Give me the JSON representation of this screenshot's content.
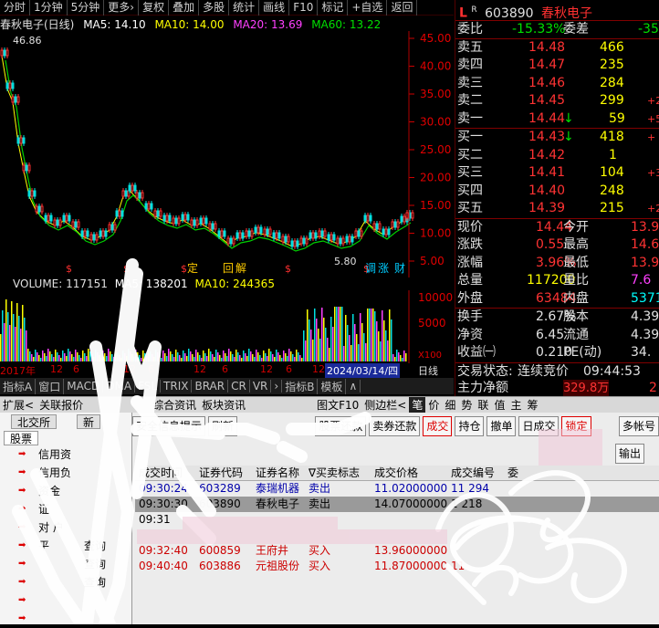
{
  "toolbar": [
    "分时",
    "1分钟",
    "5分钟",
    "更多›",
    "复权",
    "叠加",
    "多股",
    "统计",
    "画线",
    "F10",
    "标记",
    "+自选",
    "返回"
  ],
  "ma_line": {
    "title": "春秋电子(日线)",
    "ma5": "MA5: 14.10",
    "ma10": "MA10: 14.00",
    "ma20": "MA20: 13.69",
    "ma60": "MA60: 13.22"
  },
  "price_marks": {
    "high": "46.86",
    "low": "5.80"
  },
  "price_axis": [
    "45.00",
    "40.00",
    "35.00",
    "30.00",
    "25.00",
    "20.00",
    "15.00",
    "10.00",
    "5.00"
  ],
  "vol_line": {
    "volume": "VOLUME: 117151",
    "ma5": "MA5: 138201",
    "ma10": "MA10: 244365"
  },
  "vol_axis": [
    "10000",
    "5000",
    "X100"
  ],
  "date_axis": [
    "2017年",
    "12",
    "6",
    "12",
    "6",
    "12",
    "6",
    "12",
    "6",
    "12",
    "6",
    "12",
    "6",
    "12"
  ],
  "date_highlight": "2024/03/14/四",
  "date_right": "日线",
  "event_tags": [
    "定",
    "回",
    "解",
    "调",
    "涨",
    "财"
  ],
  "bottom_tabs": [
    "指标A",
    "窗口",
    "MACD",
    "DMA",
    "FSL",
    "TRIX",
    "BRAR",
    "CR",
    "VR",
    "›",
    "指标B",
    "模板",
    "∧"
  ],
  "quote": {
    "marker": "L",
    "sup": "R",
    "code": "603890",
    "name": "春秋电子",
    "weibi_label": "委比",
    "weibi": "-15.33%",
    "weicha_label": "委差",
    "weicha": "-35",
    "sell": [
      {
        "label": "卖五",
        "price": "14.48",
        "vol": "466",
        "chg": ""
      },
      {
        "label": "卖四",
        "price": "14.47",
        "vol": "235",
        "chg": ""
      },
      {
        "label": "卖三",
        "price": "14.46",
        "vol": "284",
        "chg": ""
      },
      {
        "label": "卖二",
        "price": "14.45",
        "vol": "299",
        "chg": "+2"
      },
      {
        "label": "卖一",
        "price": "14.44",
        "vol": "59",
        "chg": "+5",
        "arrow": "↓"
      }
    ],
    "buy": [
      {
        "label": "买一",
        "price": "14.43",
        "vol": "418",
        "chg": "+",
        "arrow": "↓"
      },
      {
        "label": "买二",
        "price": "14.42",
        "vol": "1",
        "chg": ""
      },
      {
        "label": "买三",
        "price": "14.41",
        "vol": "104",
        "chg": "+3"
      },
      {
        "label": "买四",
        "price": "14.40",
        "vol": "248",
        "chg": ""
      },
      {
        "label": "买五",
        "price": "14.39",
        "vol": "215",
        "chg": "+21"
      }
    ],
    "stats": [
      {
        "l1": "现价",
        "v1": "14.44",
        "l2": "今开",
        "v2": "13.9"
      },
      {
        "l1": "涨跌",
        "v1": "0.55",
        "l2": "最高",
        "v2": "14.6"
      },
      {
        "l1": "涨幅",
        "v1": "3.96%",
        "l2": "最低",
        "v2": "13.9"
      },
      {
        "l1": "总量",
        "v1": "117200",
        "l2": "量比",
        "v2": "7.6"
      },
      {
        "l1": "外盘",
        "v1": "63484",
        "l2": "内盘",
        "v2": "5371"
      }
    ],
    "stats2": [
      {
        "l1": "换手",
        "v1": "2.67%",
        "l2": "股本",
        "v2": "4.39亿"
      },
      {
        "l1": "净资",
        "v1": "6.45",
        "l2": "流通",
        "v2": "4.39亿"
      },
      {
        "l1": "收益㈠",
        "v1": "0.210",
        "l2": "PE(动)",
        "v2": "34."
      }
    ],
    "status_label": "交易状态:",
    "status": "连续竞价",
    "time": "09:44:53",
    "zl_label": "主力净额",
    "zl": "329.8万",
    "zl2": "2"
  },
  "footer": [
    "扩展<",
    "关联报价",
    "",
    "",
    "",
    "综合资讯",
    "板块资讯",
    "",
    "",
    "",
    "",
    "图文F10",
    "侧边栏<",
    "笔",
    "价",
    "细",
    "势",
    "联",
    "值",
    "主",
    "筹"
  ],
  "trade": {
    "nav_tabs": [
      "北交所",
      "新",
      "股票"
    ],
    "nav_items": [
      "信用资",
      "信用负",
      "资金",
      "证",
      "对 户",
      "平 ",
      "",
      "",
      "",
      ""
    ],
    "nav_items2": [
      "",
      "",
      "",
      "",
      "",
      "查询",
      "查询",
      "查询",
      "",
      ""
    ],
    "buttons": [
      "安全信息提示",
      "刷新",
      "",
      "",
      "",
      "股票还款",
      "卖券还款",
      "成交",
      "持仓",
      "撤单",
      "日成交",
      "锁定",
      "",
      "多帐号"
    ],
    "output_label": "输出",
    "columns": [
      "成交时间",
      "证券代码",
      "证券名称",
      "∇买卖标志",
      "成交价格",
      "成交编号",
      "委"
    ],
    "rows": [
      {
        "time": "09:30:24",
        "code": "603289",
        "name": "泰瑞机器",
        "side": "卖出",
        "price": "11.02000000",
        "no": "11 294"
      },
      {
        "time": "09:30:30",
        "code": "603890",
        "name": "春秋电子",
        "side": "卖出",
        "price": "14.07000000",
        "no": "1 218"
      },
      {
        "time": "09:31",
        "code": "",
        "name": "",
        "side": "",
        "price": "",
        "no": ""
      },
      {
        "time": "",
        "code": "",
        "name": "",
        "side": "",
        "price": "",
        "no": ""
      },
      {
        "time": "09:32:40",
        "code": "600859",
        "name": "王府井",
        "side": "买入",
        "price": "13.96000000",
        "no": ""
      },
      {
        "time": "09:40:40",
        "code": "603886",
        "name": "元祖股份",
        "side": "买入",
        "price": "11.87000000",
        "no": "11"
      }
    ]
  }
}
